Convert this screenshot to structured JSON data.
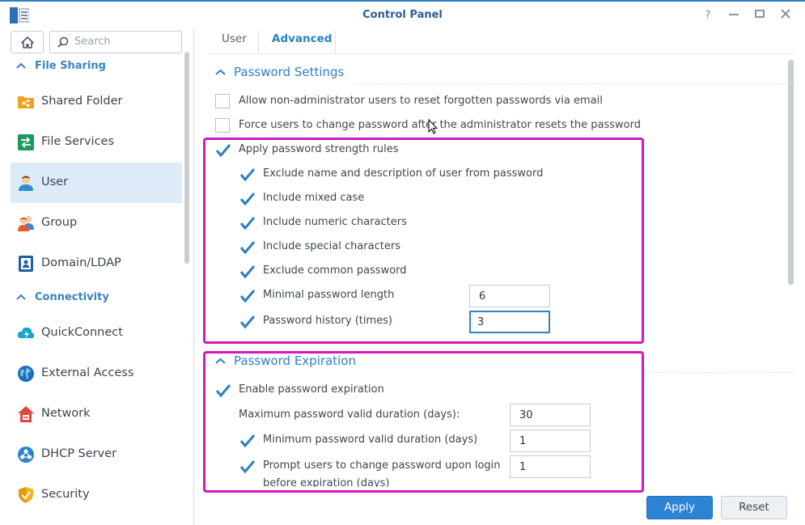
{
  "window": {
    "title": "Control Panel",
    "help_icon": "help-icon",
    "minimize_icon": "minimize-icon",
    "maximize_icon": "maximize-icon",
    "close_icon": "close-icon"
  },
  "sidebar": {
    "search_placeholder": "Search",
    "sections": [
      {
        "label": "File Sharing",
        "items": [
          {
            "label": "Shared Folder",
            "icon": "shared-folder-icon"
          },
          {
            "label": "File Services",
            "icon": "file-services-icon"
          },
          {
            "label": "User",
            "icon": "user-icon",
            "active": true
          },
          {
            "label": "Group",
            "icon": "group-icon"
          },
          {
            "label": "Domain/LDAP",
            "icon": "domain-ldap-icon"
          }
        ]
      },
      {
        "label": "Connectivity",
        "items": [
          {
            "label": "QuickConnect",
            "icon": "quickconnect-icon"
          },
          {
            "label": "External Access",
            "icon": "external-access-icon"
          },
          {
            "label": "Network",
            "icon": "network-icon"
          },
          {
            "label": "DHCP Server",
            "icon": "dhcp-server-icon"
          },
          {
            "label": "Security",
            "icon": "security-icon"
          }
        ]
      }
    ]
  },
  "tabs": [
    {
      "label": "User",
      "active": false
    },
    {
      "label": "Advanced",
      "active": true
    }
  ],
  "password_settings": {
    "title": "Password Settings",
    "allow_reset_email": {
      "label": "Allow non-administrator users to reset forgotten passwords via email",
      "checked": false
    },
    "force_change": {
      "label": "Force users to change password after the administrator resets the password",
      "checked": false
    },
    "strength_rules": {
      "label": "Apply password strength rules",
      "checked": true
    },
    "rules": [
      {
        "label": "Exclude name and description of user from password",
        "checked": true
      },
      {
        "label": "Include mixed case",
        "checked": true
      },
      {
        "label": "Include numeric characters",
        "checked": true
      },
      {
        "label": "Include special characters",
        "checked": true
      },
      {
        "label": "Exclude common password",
        "checked": true
      },
      {
        "label": "Minimal password length",
        "checked": true,
        "value": "6"
      },
      {
        "label": "Password history (times)",
        "checked": true,
        "value": "3"
      }
    ]
  },
  "password_expiration": {
    "title": "Password Expiration",
    "enable": {
      "label": "Enable password expiration",
      "checked": true
    },
    "max_duration": {
      "label": "Maximum password valid duration (days):",
      "value": "30"
    },
    "min_duration": {
      "label": "Minimum password valid duration (days)",
      "checked": true,
      "value": "1"
    },
    "prompt": {
      "label": "Prompt users to change password upon login",
      "label2": "before expiration (days)",
      "checked": true,
      "value": "1"
    }
  },
  "footer": {
    "apply_label": "Apply",
    "reset_label": "Reset"
  },
  "colors": {
    "accent": "#2f7fc4",
    "highlight": "#d417c1",
    "active_nav": "#dcebf7"
  }
}
